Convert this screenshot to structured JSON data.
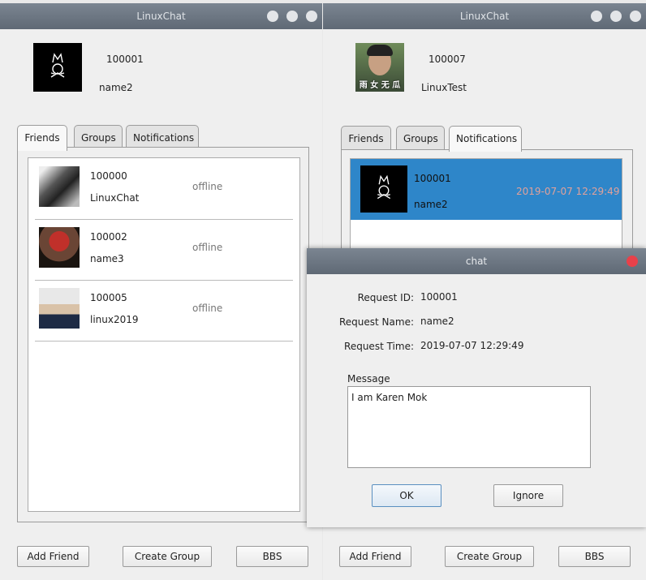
{
  "left_window": {
    "title": "LinuxChat",
    "user_id": "100001",
    "user_name": "name2",
    "tabs": [
      "Friends",
      "Groups",
      "Notifications"
    ],
    "friends": [
      {
        "id": "100000",
        "name": "LinuxChat",
        "status": "offline"
      },
      {
        "id": "100002",
        "name": "name3",
        "status": "offline"
      },
      {
        "id": "100005",
        "name": "linux2019",
        "status": "offline"
      }
    ],
    "buttons": {
      "add_friend": "Add Friend",
      "create_group": "Create Group",
      "bbs": "BBS"
    }
  },
  "right_window": {
    "title": "LinuxChat",
    "user_id": "100007",
    "user_name": "LinuxTest",
    "avatar_text": "雨 女 无 瓜",
    "tabs": [
      "Friends",
      "Groups",
      "Notifications"
    ],
    "notification": {
      "id": "100001",
      "name": "name2",
      "time": "2019-07-07 12:29:49"
    },
    "buttons": {
      "add_friend": "Add Friend",
      "create_group": "Create Group",
      "bbs": "BBS"
    }
  },
  "dialog": {
    "title": "chat",
    "request_id_label": "Request ID:",
    "request_id": "100001",
    "request_name_label": "Request Name:",
    "request_name": "name2",
    "request_time_label": "Request Time:",
    "request_time": "2019-07-07 12:29:49",
    "message_label": "Message",
    "message": "I am Karen Mok",
    "ok_label": "OK",
    "ignore_label": "Ignore"
  },
  "colors": {
    "titlebar": "#6b7581",
    "selected_row": "#2e86c9",
    "close_button": "#e8414a"
  }
}
